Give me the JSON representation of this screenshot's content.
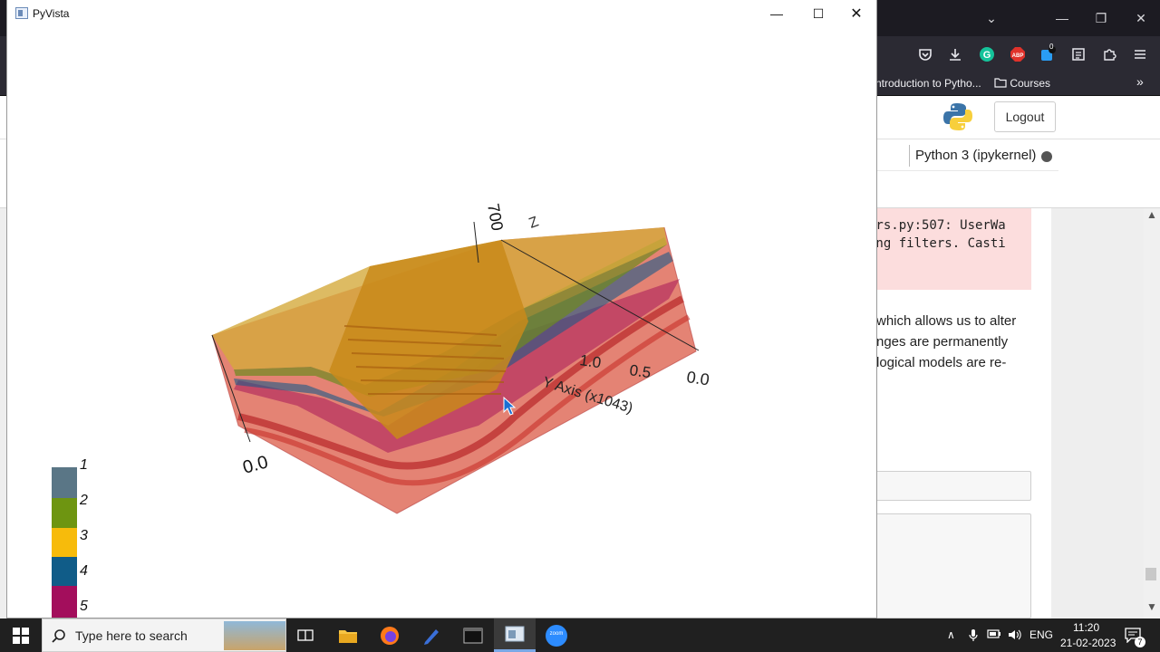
{
  "pyvista": {
    "title": "PyVista",
    "controls": {
      "minimize": "—",
      "maximize": "☐",
      "close": "✕"
    },
    "scene": {
      "axis_labels": {
        "y_title": "Y Axis (x1043)",
        "y_ticks": [
          "1.0",
          "0.5",
          "0.0"
        ],
        "x_origin": "0.0",
        "z_top": "700",
        "z_letter": "Z"
      }
    },
    "legend": {
      "items": [
        {
          "label": "1",
          "color": "#5a7686"
        },
        {
          "label": "2",
          "color": "#6e9511"
        },
        {
          "label": "3",
          "color": "#f7bb0b"
        },
        {
          "label": "4",
          "color": "#105c88"
        },
        {
          "label": "5",
          "color": "#a30e5c"
        }
      ]
    }
  },
  "browser": {
    "tab_controls": {
      "dropdown": "⌄",
      "minimize": "—",
      "restore": "❐",
      "close": "✕"
    },
    "toolbar_badge": "0",
    "bookmarks": [
      {
        "label": "ntroduction to Pytho..."
      },
      {
        "label": "Courses"
      }
    ],
    "notebook": {
      "logout_label": "Logout",
      "kernel_name": "Python 3 (ipykernel)",
      "warning_lines": [
        "ers.py:507: UserWa",
        "ing filters. Casti"
      ],
      "markdown_lines": [
        "which allows us to alter",
        "nges are permanently",
        "logical models are re-"
      ]
    }
  },
  "taskbar": {
    "search_placeholder": "Type here to search",
    "language": "ENG",
    "time": "11:20",
    "date": "21-02-2023",
    "notification_count": "7",
    "zoom_label": "zoom"
  }
}
